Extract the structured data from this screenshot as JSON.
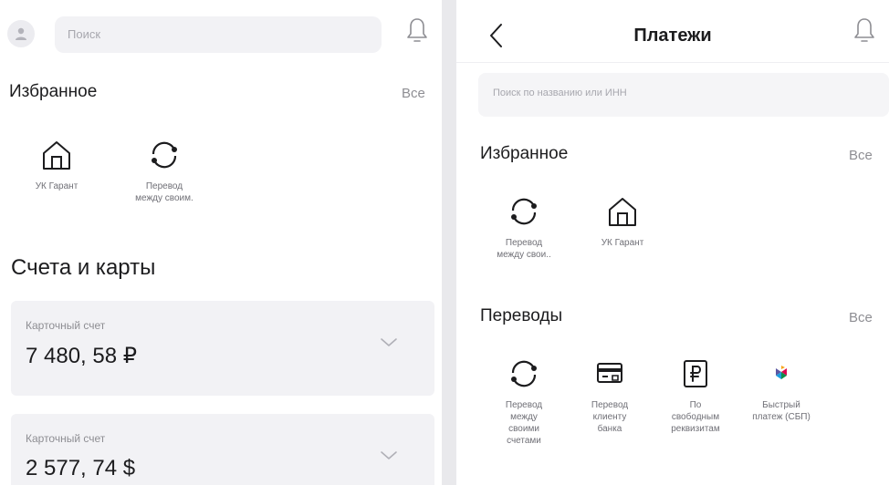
{
  "left": {
    "search": {
      "placeholder": "Поиск"
    },
    "favorites": {
      "title": "Избранное",
      "all": "Все",
      "items": [
        {
          "label": "УК Гарант",
          "icon": "house-icon"
        },
        {
          "label": "Перевод\nмежду своим.",
          "icon": "transfer-cycle-icon"
        }
      ]
    },
    "accounts": {
      "title": "Счета и карты",
      "items": [
        {
          "label": "Карточный счет",
          "amount": "7 480, 58 ₽"
        },
        {
          "label": "Карточный счет",
          "amount": "2 577, 74 $"
        }
      ]
    }
  },
  "right": {
    "title": "Платежи",
    "search": {
      "placeholder": "Поиск по названию или ИНН"
    },
    "favorites": {
      "title": "Избранное",
      "all": "Все",
      "items": [
        {
          "label": "Перевод\nмежду свои..",
          "icon": "transfer-cycle-icon"
        },
        {
          "label": "УК Гарант",
          "icon": "house-icon"
        }
      ]
    },
    "transfers": {
      "title": "Переводы",
      "all": "Все",
      "items": [
        {
          "label": "Перевод\nмежду\nсвоими\nсчетами",
          "icon": "transfer-cycle-icon"
        },
        {
          "label": "Перевод\nклиенту\nбанка",
          "icon": "bank-card-icon"
        },
        {
          "label": "По\nсвободным\nреквизитам",
          "icon": "ruble-document-icon"
        },
        {
          "label": "Быстрый\nплатеж (СБП)",
          "icon": "sbp-logo-icon"
        }
      ]
    }
  },
  "colors": {
    "background": "#ffffff",
    "divider": "#e9e9ec",
    "card": "#f2f2f5",
    "muted_text": "#8e8e93",
    "primary_text": "#1c1c1e"
  }
}
